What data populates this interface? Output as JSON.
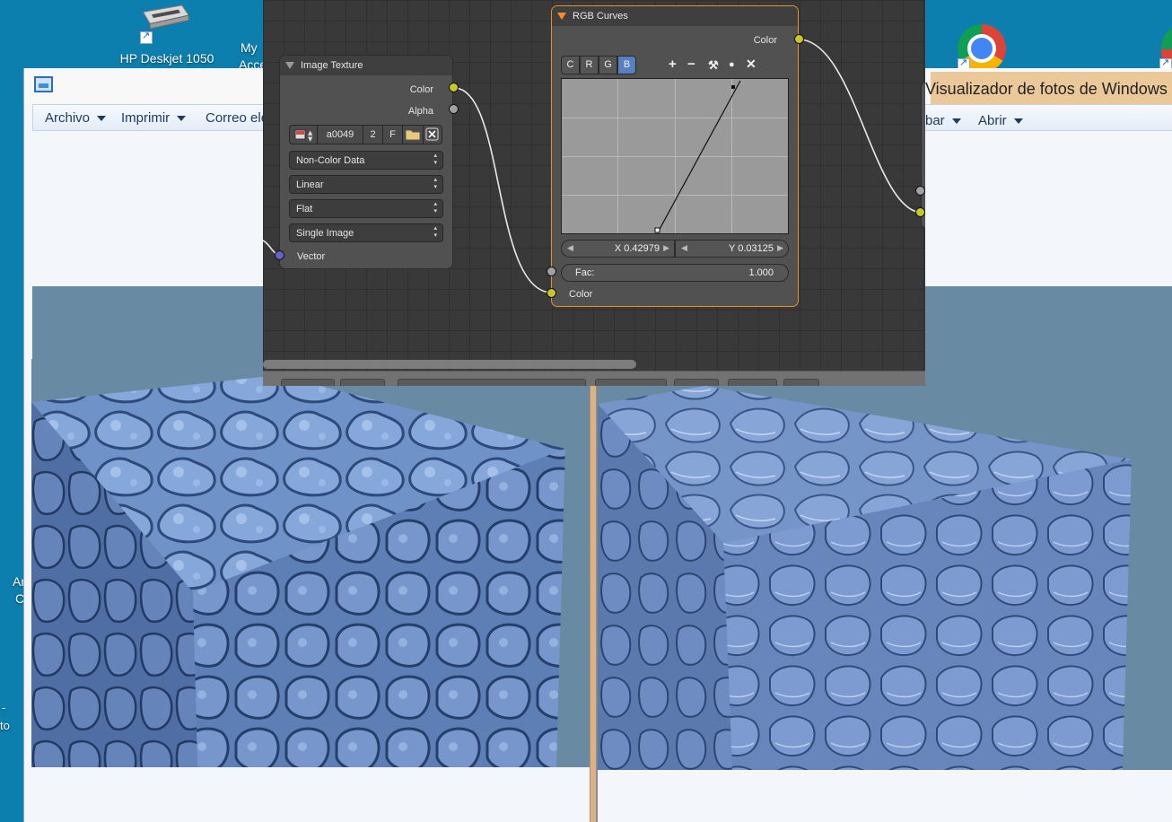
{
  "desktop": {
    "icons": [
      {
        "label": "HP Deskjet 1050"
      },
      {
        "label_line1": "My",
        "label_line2": "Acce"
      },
      {
        "label_line1": "Ar",
        "label_line2": "C"
      },
      {
        "label_line1": "-",
        "label_line2": "to"
      }
    ]
  },
  "viewer": {
    "title": "Visualizador de fotos de Windows",
    "menu_left": [
      {
        "label": "Archivo"
      },
      {
        "label": "Imprimir"
      },
      {
        "label": "Correo ele"
      }
    ],
    "menu_right": [
      {
        "label": "bar"
      },
      {
        "label": "Abrir"
      }
    ]
  },
  "node_editor": {
    "image_texture": {
      "title": "Image Texture",
      "outputs": [
        "Color",
        "Alpha"
      ],
      "image_name": "a0049",
      "users": "2",
      "fake_user": "F",
      "color_space": "Non-Color Data",
      "interpolation": "Linear",
      "projection": "Flat",
      "source": "Single Image",
      "input": "Vector"
    },
    "rgb_curves": {
      "title": "RGB Curves",
      "output": "Color",
      "channels": [
        "C",
        "R",
        "G",
        "B"
      ],
      "active_channel": "B",
      "tools": [
        "+",
        "−",
        "⚒",
        "●",
        "✕"
      ],
      "x_field": "X 0.42979",
      "y_field": "Y 0.03125",
      "fac_label": "Fac:",
      "fac_value": "1.000",
      "input": "Color"
    }
  },
  "colors": {
    "socket_color": "#c7c729",
    "socket_shader": "#a1a1a1",
    "socket_vector": "#6363c7",
    "selected_outline": "#e7932c",
    "desktop_bg": "#0c7fae",
    "render_bg": "#688aa3"
  }
}
